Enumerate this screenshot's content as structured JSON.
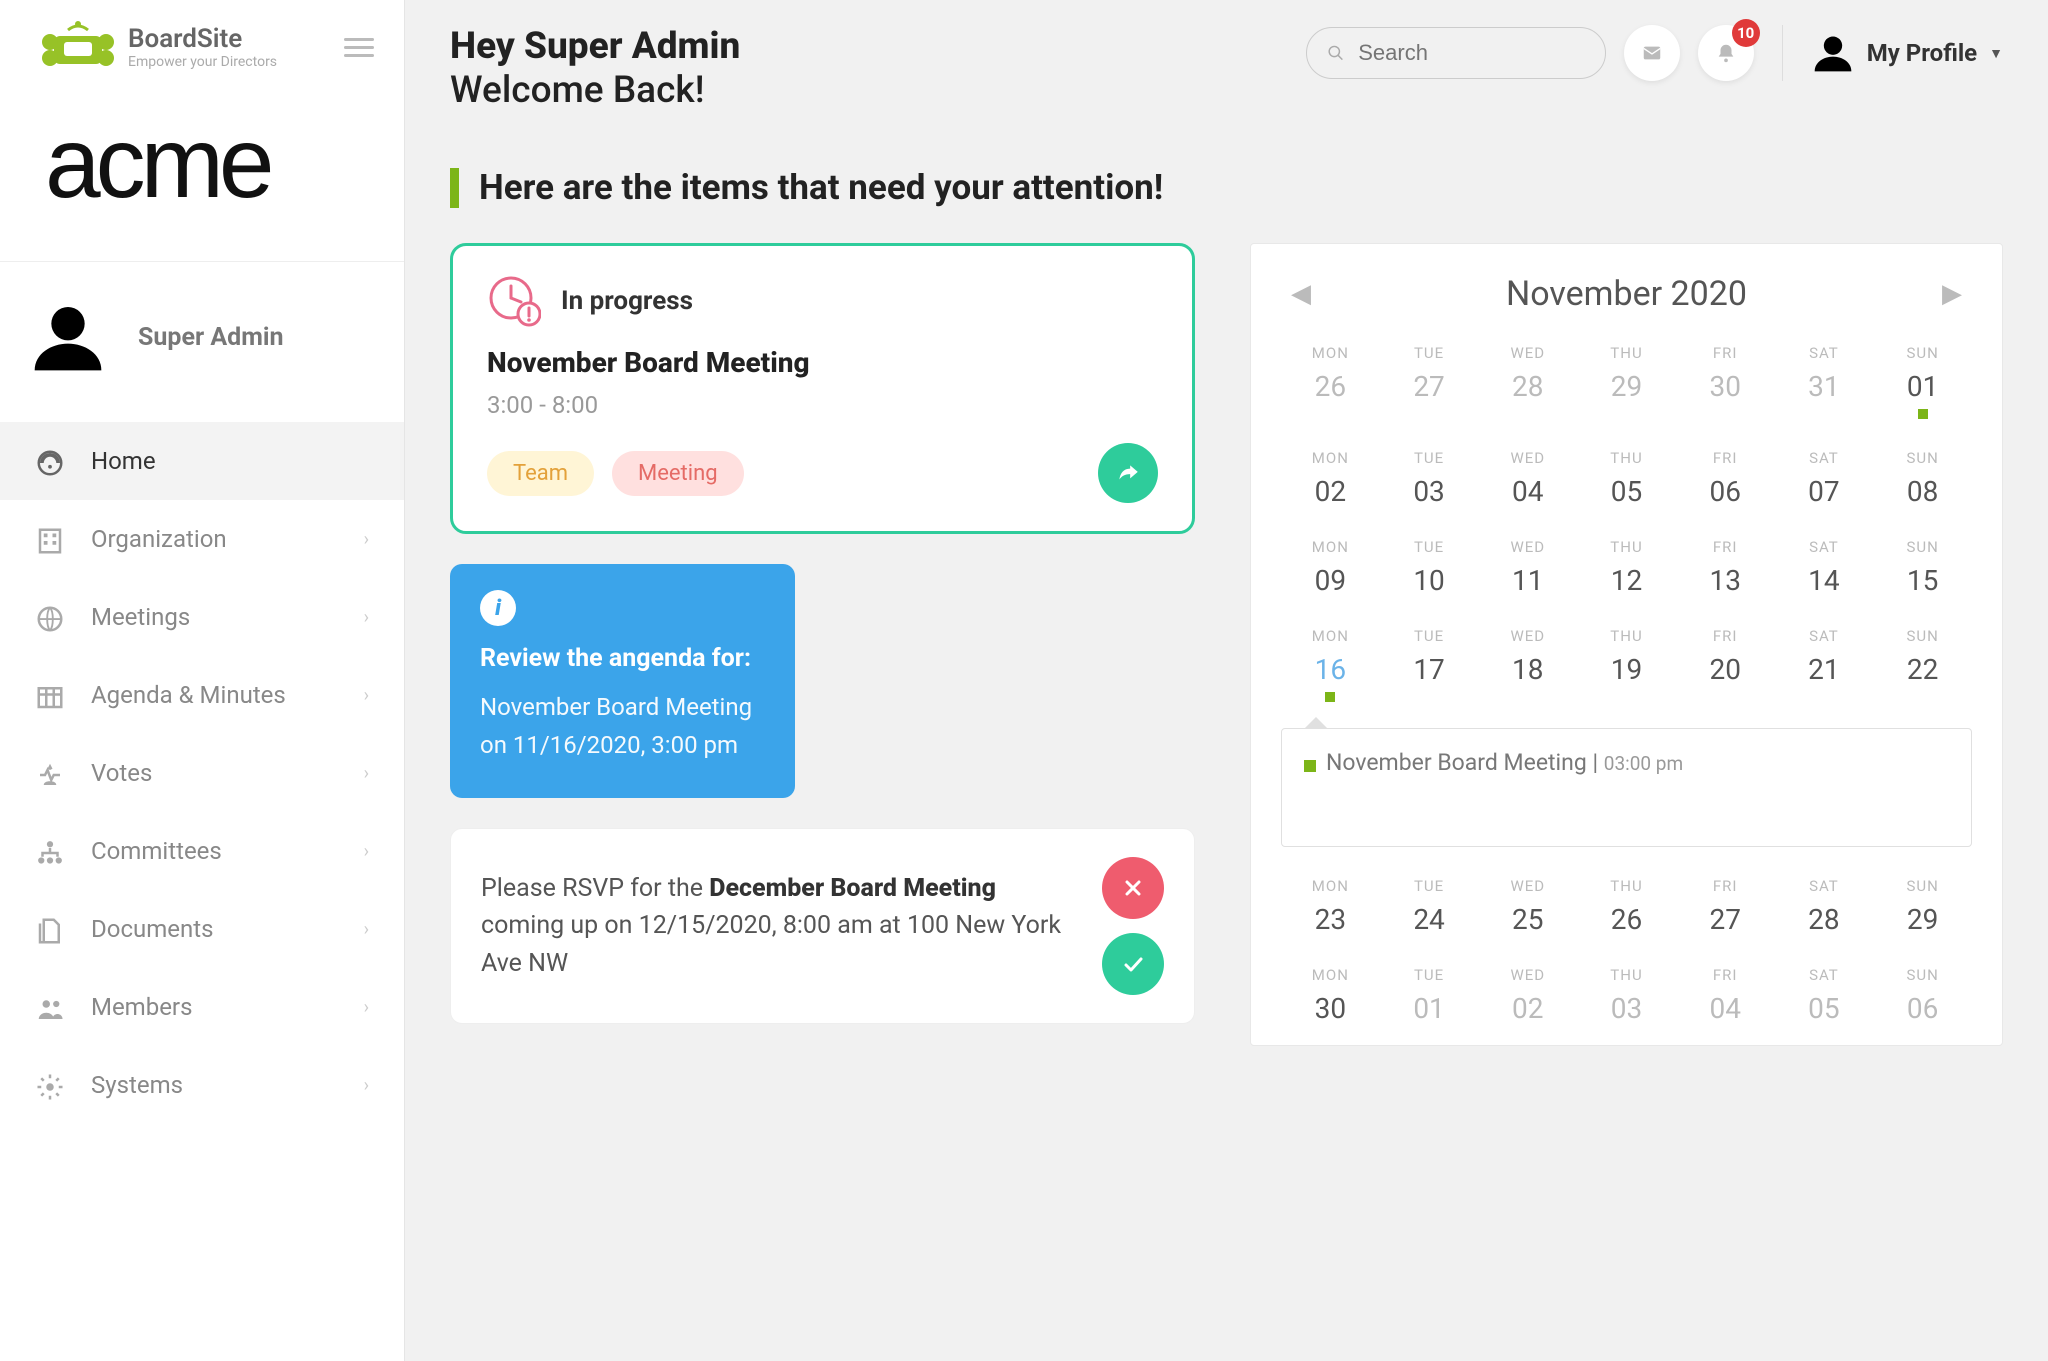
{
  "brand": {
    "name": "BoardSite",
    "tagline": "Empower your Directors"
  },
  "org": "acme",
  "user": "Super Admin",
  "nav": [
    {
      "label": "Home",
      "has_children": false
    },
    {
      "label": "Organization",
      "has_children": true
    },
    {
      "label": "Meetings",
      "has_children": true
    },
    {
      "label": "Agenda & Minutes",
      "has_children": true
    },
    {
      "label": "Votes",
      "has_children": true
    },
    {
      "label": "Committees",
      "has_children": true
    },
    {
      "label": "Documents",
      "has_children": true
    },
    {
      "label": "Members",
      "has_children": true
    },
    {
      "label": "Systems",
      "has_children": true
    }
  ],
  "greeting": {
    "line1": "Hey Super Admin",
    "line2": "Welcome Back!"
  },
  "search_placeholder": "Search",
  "notification_count": "10",
  "profile_label": "My Profile",
  "attention_heading": "Here are the items that need your attention!",
  "progress_card": {
    "status": "In progress",
    "title": "November Board Meeting",
    "time": "3:00 - 8:00",
    "tags": [
      "Team",
      "Meeting"
    ]
  },
  "agenda_card": {
    "title": "Review the angenda for:",
    "body": "November Board Meeting on 11/16/2020, 3:00 pm"
  },
  "rsvp_card": {
    "prefix": "Please RSVP for the ",
    "bold": "December Board Meeting",
    "suffix": " coming up on 12/15/2020, 8:00 am at 100 New York Ave NW"
  },
  "calendar": {
    "month": "November 2020",
    "days_of_week": [
      "MON",
      "TUE",
      "WED",
      "THU",
      "FRI",
      "SAT",
      "SUN"
    ],
    "weeks": [
      [
        {
          "n": "26",
          "other": true
        },
        {
          "n": "27",
          "other": true
        },
        {
          "n": "28",
          "other": true
        },
        {
          "n": "29",
          "other": true
        },
        {
          "n": "30",
          "other": true
        },
        {
          "n": "31",
          "other": true
        },
        {
          "n": "01",
          "dot": true
        }
      ],
      [
        {
          "n": "02"
        },
        {
          "n": "03"
        },
        {
          "n": "04"
        },
        {
          "n": "05"
        },
        {
          "n": "06"
        },
        {
          "n": "07"
        },
        {
          "n": "08"
        }
      ],
      [
        {
          "n": "09"
        },
        {
          "n": "10"
        },
        {
          "n": "11"
        },
        {
          "n": "12"
        },
        {
          "n": "13"
        },
        {
          "n": "14"
        },
        {
          "n": "15"
        }
      ],
      [
        {
          "n": "16",
          "selected": true,
          "dot": true
        },
        {
          "n": "17"
        },
        {
          "n": "18"
        },
        {
          "n": "19"
        },
        {
          "n": "20"
        },
        {
          "n": "21"
        },
        {
          "n": "22"
        }
      ],
      [
        {
          "n": "23"
        },
        {
          "n": "24"
        },
        {
          "n": "25"
        },
        {
          "n": "26"
        },
        {
          "n": "27"
        },
        {
          "n": "28"
        },
        {
          "n": "29"
        }
      ],
      [
        {
          "n": "30"
        },
        {
          "n": "01",
          "other": true
        },
        {
          "n": "02",
          "other": true
        },
        {
          "n": "03",
          "other": true
        },
        {
          "n": "04",
          "other": true
        },
        {
          "n": "05",
          "other": true
        },
        {
          "n": "06",
          "other": true
        }
      ]
    ],
    "event": {
      "title": "November Board Meeting",
      "time": "03:00 pm"
    }
  }
}
